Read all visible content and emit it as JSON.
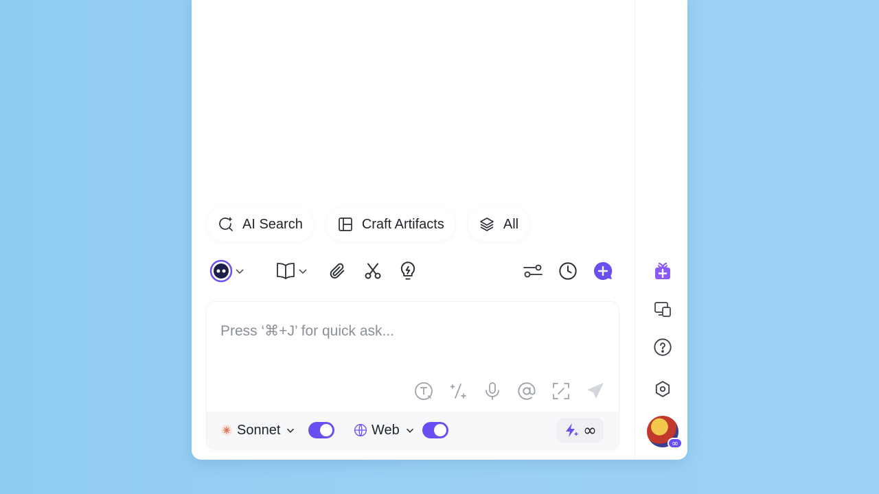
{
  "chips": [
    {
      "label": "AI Search",
      "icon": "search-sparkle-icon"
    },
    {
      "label": "Craft Artifacts",
      "icon": "layout-icon"
    },
    {
      "label": "All",
      "icon": "layers-icon"
    }
  ],
  "toolbar": {
    "bot_icon": "bot-face-icon",
    "book_icon": "book-icon",
    "attach_icon": "paperclip-icon",
    "scissors_icon": "scissors-icon",
    "bulb_icon": "lightbulb-icon",
    "settings_icon": "sliders-icon",
    "history_icon": "clock-icon",
    "new_chat_icon": "new-chat-icon"
  },
  "input": {
    "placeholder": "Press ‘⌘+J’ for quick ask...",
    "value": ""
  },
  "bottom_bar": {
    "model_label": "Sonnet",
    "model_toggle_on": true,
    "web_label": "Web",
    "web_toggle_on": true,
    "boost_symbol": "∞"
  },
  "avatar_badge": "∞",
  "colors": {
    "accent": "#6a4ff0",
    "background_blue": "#99d0f5"
  }
}
